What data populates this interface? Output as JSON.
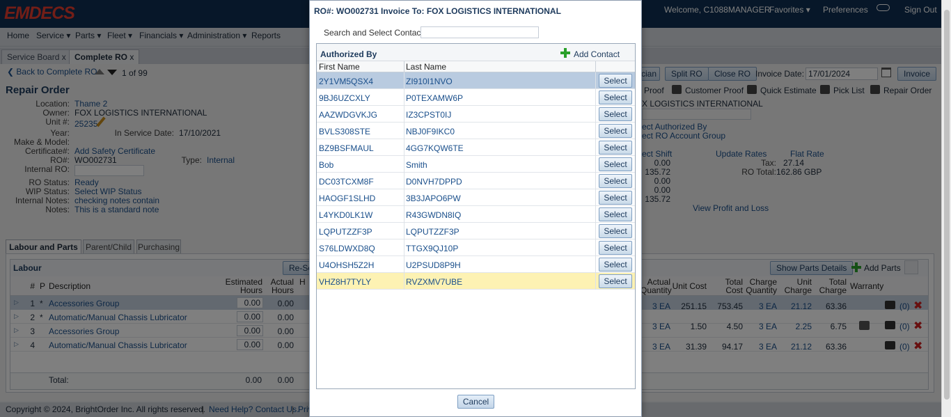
{
  "header": {
    "logo": "EMDECS",
    "welcome": "Welcome, C1088MANAGER",
    "favorites": "Favorites",
    "preferences": "Preferences",
    "sign_out": "Sign Out"
  },
  "menu": [
    "Home",
    "Service",
    "Parts",
    "Fleet",
    "Financials",
    "Administration",
    "Reports"
  ],
  "tabs": [
    {
      "label": "Service Board",
      "close": "x"
    },
    {
      "label": "Complete RO",
      "close": "x"
    }
  ],
  "nav": {
    "back": "Back to Complete RO",
    "position": "1",
    "of": "of",
    "total": "99"
  },
  "toolbar": {
    "tech_btn": "cian",
    "split_ro": "Split RO",
    "close_ro": "Close RO",
    "invoice_date_label": "Invoice Date:",
    "invoice_date": "17/01/2024",
    "invoice": "Invoice"
  },
  "print_links": [
    "Proof",
    "Customer Proof",
    "Quick Estimate",
    "Pick List",
    "Repair Order"
  ],
  "repair_order": {
    "title": "Repair Order",
    "location_label": "Location:",
    "location": "Thame 2",
    "owner_label": "Owner:",
    "owner": "FOX LOGISTICS INTERNATIONAL",
    "unit_label": "Unit #:",
    "unit": "25235",
    "year_label": "Year:",
    "in_service_label": "In Service Date:",
    "in_service": "17/10/2021",
    "make_label": "Make & Model:",
    "cert_label": "Certificate#:",
    "cert": "Add Safety Certificate",
    "ro_label": "RO#:",
    "ro": "WO002731",
    "type_label": "Type:",
    "type": "Internal",
    "internal_ro_label": "Internal RO:",
    "status_label": "RO Status:",
    "status": "Ready",
    "wip_label": "WIP Status:",
    "wip": "Select WIP Status",
    "notes_int_label": "Internal Notes:",
    "notes_int": "checking notes contain",
    "notes_label": "Notes:",
    "notes": "This is a standard note"
  },
  "right_info": {
    "customer": "X LOGISTICS INTERNATIONAL",
    "auth_by": "ect Authorized By",
    "acct_group": "ect RO Account Group",
    "shift": "ect Shift",
    "vals": [
      "0.00",
      "135.72",
      "0.00",
      "0.00",
      "135.72"
    ],
    "update_rates": "Update Rates",
    "flat_rate": "Flat Rate",
    "tax_label": "Tax:",
    "tax": "27.14",
    "total_label": "RO Total:",
    "total": "162.86",
    "currency": "GBP",
    "profit": "View Profit and Loss"
  },
  "section_tabs": [
    "Labour and Parts",
    "Parent/Child",
    "Purchasing"
  ],
  "labour": {
    "title": "Labour",
    "reset_btn": "Re-Se",
    "headers": [
      "#",
      "P",
      "Description",
      "Estimated Hours",
      "Actual Hours",
      "H"
    ],
    "rows": [
      {
        "n": "1",
        "p": "*",
        "desc": "Accessories Group",
        "est": "0.00",
        "act": "0.00"
      },
      {
        "n": "2",
        "p": "*",
        "desc": "Automatic/Manual Chassis Lubricator",
        "est": "0.00",
        "act": "0.00"
      },
      {
        "n": "3",
        "p": "",
        "desc": "Accessories Group",
        "est": "0.00",
        "act": "0.00"
      },
      {
        "n": "4",
        "p": "",
        "desc": "Automatic/Manual Chassis Lubricator",
        "est": "0.00",
        "act": "0.00"
      }
    ],
    "total_label": "Total:",
    "total_est": "0.00",
    "total_act": "0.00"
  },
  "parts": {
    "show_details": "Show Parts Details",
    "add_parts": "Add Parts",
    "headers": [
      "Actual Quantity",
      "Unit Cost",
      "Total Cost",
      "Charge Quantity",
      "Unit Charge",
      "Total Charge",
      "Warranty"
    ],
    "rows": [
      {
        "aq": "3 EA",
        "uc": "251.15",
        "tc": "753.45",
        "cq": "3 EA",
        "uch": "21.12",
        "tch": "63.36",
        "count": "(0)"
      },
      {
        "aq": "3 EA",
        "uc": "1.50",
        "tc": "4.50",
        "cq": "3 EA",
        "uch": "2.25",
        "tch": "6.75",
        "count": "(0)"
      },
      {
        "aq": "3 EA",
        "uc": "31.39",
        "tc": "94.17",
        "cq": "3 EA",
        "uch": "21.12",
        "tch": "63.36",
        "count": "(0)"
      }
    ]
  },
  "footer": {
    "copyright": "Copyright © 2024, BrightOrder Inc. All rights reserved.",
    "help": "Need Help? Contact Us.",
    "priv": "Priv"
  },
  "modal": {
    "title": "RO#: WO002731 Invoice To: FOX LOGISTICS INTERNATIONAL",
    "search_label": "Search and Select Contact:",
    "search_value": "",
    "panel_title": "Authorized By",
    "add_contact": "Add Contact",
    "col_first": "First Name",
    "col_last": "Last Name",
    "select_label": "Select",
    "cancel": "Cancel",
    "contacts": [
      {
        "first": "2Y1VM5QSX4",
        "last": "ZI910I1NVO"
      },
      {
        "first": "9BJ6UZCXLY",
        "last": "P0TEXAMW6P"
      },
      {
        "first": "AAZWDGVKJG",
        "last": "IZ3CPST0IJ"
      },
      {
        "first": "BVLS308STE",
        "last": "NBJ0F9IKC0"
      },
      {
        "first": "BZ9BSFMAUL",
        "last": "4GG7KQW6TE"
      },
      {
        "first": "Bob",
        "last": "Smith"
      },
      {
        "first": "DC03TCXM8F",
        "last": "D0NVH7DPPD"
      },
      {
        "first": "HAOGF1SLHD",
        "last": "3B3JAPO6PW"
      },
      {
        "first": "L4YKD0LK1W",
        "last": "R43GWDN8IQ"
      },
      {
        "first": "LQPUTZZF3P",
        "last": "LQPUTZZF3P"
      },
      {
        "first": "S76LDWXD8Q",
        "last": "TTGX9QJ10P"
      },
      {
        "first": "U4OHSH5Z2H",
        "last": "U2PSUD8P9H"
      },
      {
        "first": "VHZ8H7TYLY",
        "last": "RVZXMV7UBE"
      }
    ]
  },
  "colors": {
    "header_bg": "#0e2f52",
    "logo": "#e63d2e",
    "link": "#1a4f8b",
    "selected_row": "#b9cbe0",
    "hover_row": "#fdf2b3"
  }
}
